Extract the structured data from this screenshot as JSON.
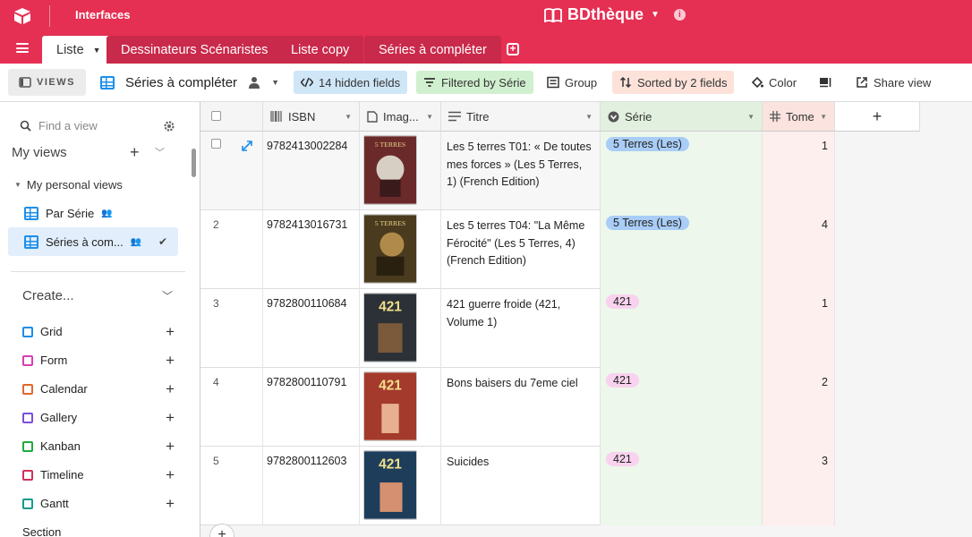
{
  "topbar": {
    "interfaces_label": "Interfaces",
    "base_name": "BDthèque",
    "bg_color": "#e52f53"
  },
  "tabs": [
    {
      "label": "Liste",
      "active": true
    },
    {
      "label": "Dessinateurs Scénaristes"
    },
    {
      "label": "Liste copy"
    },
    {
      "label": "Séries à compléter"
    }
  ],
  "toolbar": {
    "views_label": "VIEWS",
    "current_view": "Séries à compléter",
    "hidden_fields": "14 hidden fields",
    "filtered": "Filtered by Série",
    "group": "Group",
    "sorted": "Sorted by 2 fields",
    "color": "Color",
    "share": "Share view"
  },
  "sidebar": {
    "find_placeholder": "Find a view",
    "my_views": "My views",
    "personal_views": "My personal views",
    "views": [
      {
        "label": "Par Série",
        "selected": false
      },
      {
        "label": "Séries à com...",
        "selected": true
      }
    ],
    "create_label": "Create...",
    "create_items": [
      {
        "label": "Grid",
        "color": "#1d8ee8"
      },
      {
        "label": "Form",
        "color": "#d63fb5"
      },
      {
        "label": "Calendar",
        "color": "#e0692b"
      },
      {
        "label": "Gallery",
        "color": "#7a4ed9"
      },
      {
        "label": "Kanban",
        "color": "#20a942"
      },
      {
        "label": "Timeline",
        "color": "#d2305a"
      },
      {
        "label": "Gantt",
        "color": "#159a8c"
      }
    ],
    "section_label": "Section"
  },
  "columns": {
    "isbn": "ISBN",
    "image": "Imag...",
    "titre": "Titre",
    "serie": "Série",
    "tome": "Tome"
  },
  "rows": [
    {
      "num": "",
      "isbn": "9782413002284",
      "titre": "Les 5 terres T01: « De toutes mes forces » (Les 5 Terres, 1) (French Edition)",
      "serie": "5 Terres (Les)",
      "serie_color": "#a9cdf6",
      "tome": "1",
      "cover_bg": "#6b2a2a"
    },
    {
      "num": "2",
      "isbn": "9782413016731",
      "titre": "Les 5 terres T04: \"La Même Férocité\" (Les 5 Terres, 4) (French Edition)",
      "serie": "5 Terres (Les)",
      "serie_color": "#a9cdf6",
      "tome": "4",
      "cover_bg": "#4a3a1e"
    },
    {
      "num": "3",
      "isbn": "9782800110684",
      "titre": "421 guerre froide (421, Volume 1)",
      "serie": "421",
      "serie_color": "#f8d2ee",
      "tome": "1",
      "cover_bg": "#2b3136"
    },
    {
      "num": "4",
      "isbn": "9782800110791",
      "titre": "Bons baisers du 7eme ciel",
      "serie": "421",
      "serie_color": "#f8d2ee",
      "tome": "2",
      "cover_bg": "#a33a2c"
    },
    {
      "num": "5",
      "isbn": "9782800112603",
      "titre": "Suicides",
      "serie": "421",
      "serie_color": "#f8d2ee",
      "tome": "3",
      "cover_bg": "#1d3d5a"
    }
  ]
}
